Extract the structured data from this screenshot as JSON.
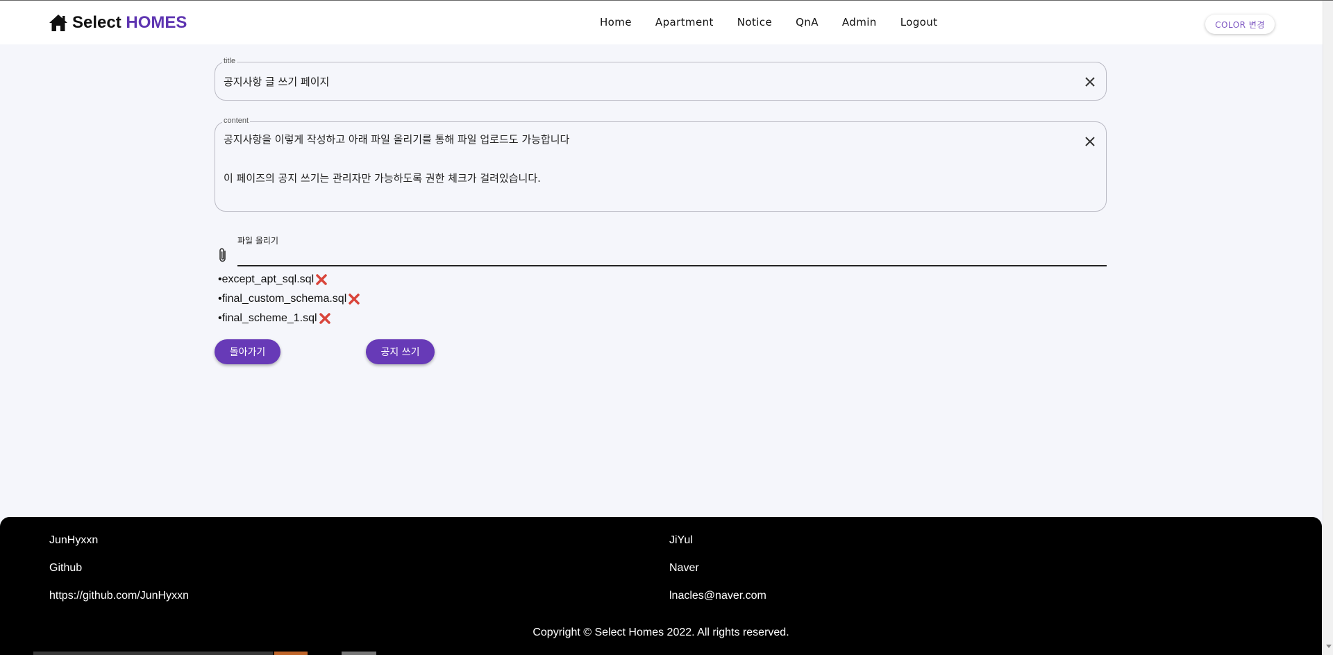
{
  "header": {
    "brand_main": "Select ",
    "brand_accent": "HOMES",
    "nav": [
      "Home",
      "Apartment",
      "Notice",
      "QnA",
      "Admin",
      "Logout"
    ],
    "color_button": "COLOR 변경"
  },
  "form": {
    "title_label": "title",
    "title_value": "공지사항 글 쓰기 페이지",
    "content_label": "content",
    "content_line1": "공지사항을 이렇게 작성하고 아래 파일 올리기를 통해 파일 업로드도 가능합니다",
    "content_line2": "이 페이즈의 공지 쓰기는 관리자만 가능하도록 권한 체크가 걸려있습니다.",
    "file_label": "파일 올리기",
    "files": [
      "•except_apt_sql.sql",
      "•final_custom_schema.sql",
      "•final_scheme_1.sql"
    ]
  },
  "buttons": {
    "back": "돌아가기",
    "submit": "공지 쓰기"
  },
  "footer": {
    "left": [
      "JunHyxxn",
      "Github",
      "https://github.com/JunHyxxn"
    ],
    "right": [
      "JiYul",
      "Naver",
      "lnacles@naver.com"
    ],
    "copyright": "Copyright © Select Homes 2022. All rights reserved."
  },
  "colors": {
    "accent": "#673ab7",
    "brand": "#5e35b1",
    "delete": "#d9453b"
  }
}
